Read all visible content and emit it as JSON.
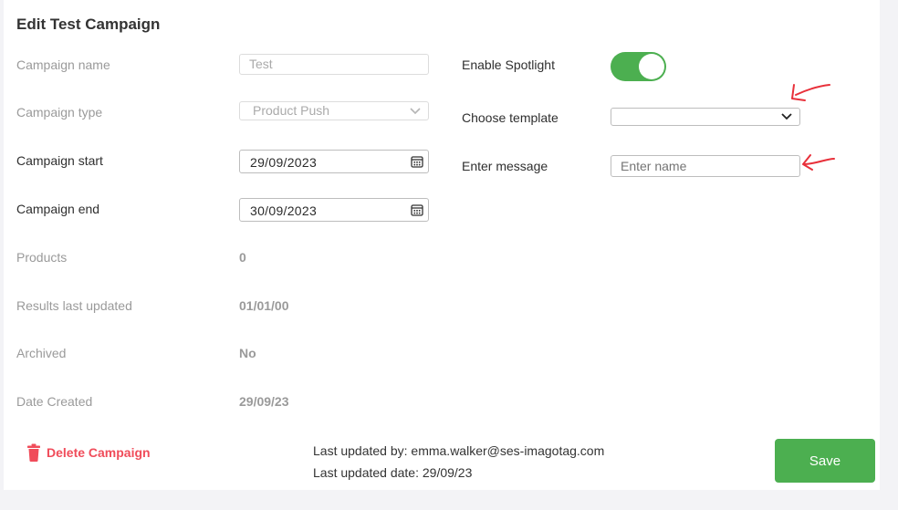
{
  "page": {
    "title": "Edit Test Campaign"
  },
  "form": {
    "campaign_name": {
      "label": "Campaign name",
      "value": "Test"
    },
    "campaign_type": {
      "label": "Campaign type",
      "value": "Product Push"
    },
    "campaign_start": {
      "label": "Campaign start",
      "value": "29/09/2023"
    },
    "campaign_end": {
      "label": "Campaign end",
      "value": "30/09/2023"
    },
    "products": {
      "label": "Products",
      "value": "0"
    },
    "results_last_updated": {
      "label": "Results last updated",
      "value": "01/01/00"
    },
    "archived": {
      "label": "Archived",
      "value": "No"
    },
    "date_created": {
      "label": "Date Created",
      "value": "29/09/23"
    }
  },
  "spotlight": {
    "enable_label": "Enable Spotlight",
    "enabled": true,
    "choose_template_label": "Choose template",
    "template_value": "",
    "enter_message_label": "Enter message",
    "message_placeholder": "Enter name"
  },
  "footer": {
    "delete_label": "Delete Campaign",
    "last_updated_by": "Last updated by: emma.walker@ses-imagotag.com",
    "last_updated_date": "Last updated date: 29/09/23",
    "save_label": "Save"
  },
  "colors": {
    "accent_green": "#4caf50",
    "delete_red": "#f04c5a",
    "annotation_red": "#e8303a"
  },
  "icons": [
    "calendar-icon",
    "chevron-down-icon",
    "trash-icon",
    "annotation-arrow-icon"
  ]
}
